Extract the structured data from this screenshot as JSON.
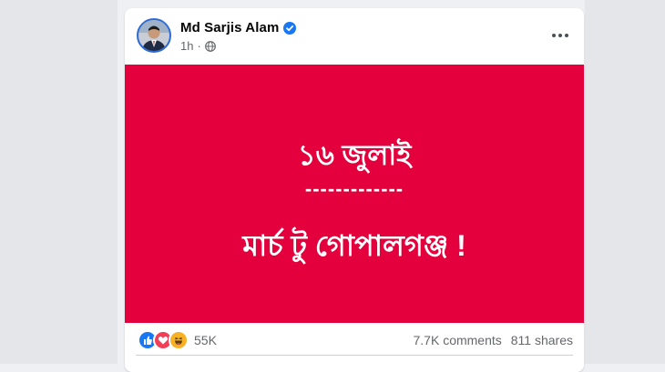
{
  "post": {
    "author_name": "Md Sarjis Alam",
    "time_ago": "1h",
    "banner": {
      "background": "#e3003d",
      "line1": "১৬ জুলাই",
      "separator": "-------------",
      "line2": "মার্চ টু গোপালগঞ্জ !"
    },
    "reactions": {
      "icons": [
        "like-icon",
        "love-icon",
        "haha-icon"
      ],
      "count": "55K"
    },
    "comments": "7.7K comments",
    "shares": "811 shares"
  }
}
